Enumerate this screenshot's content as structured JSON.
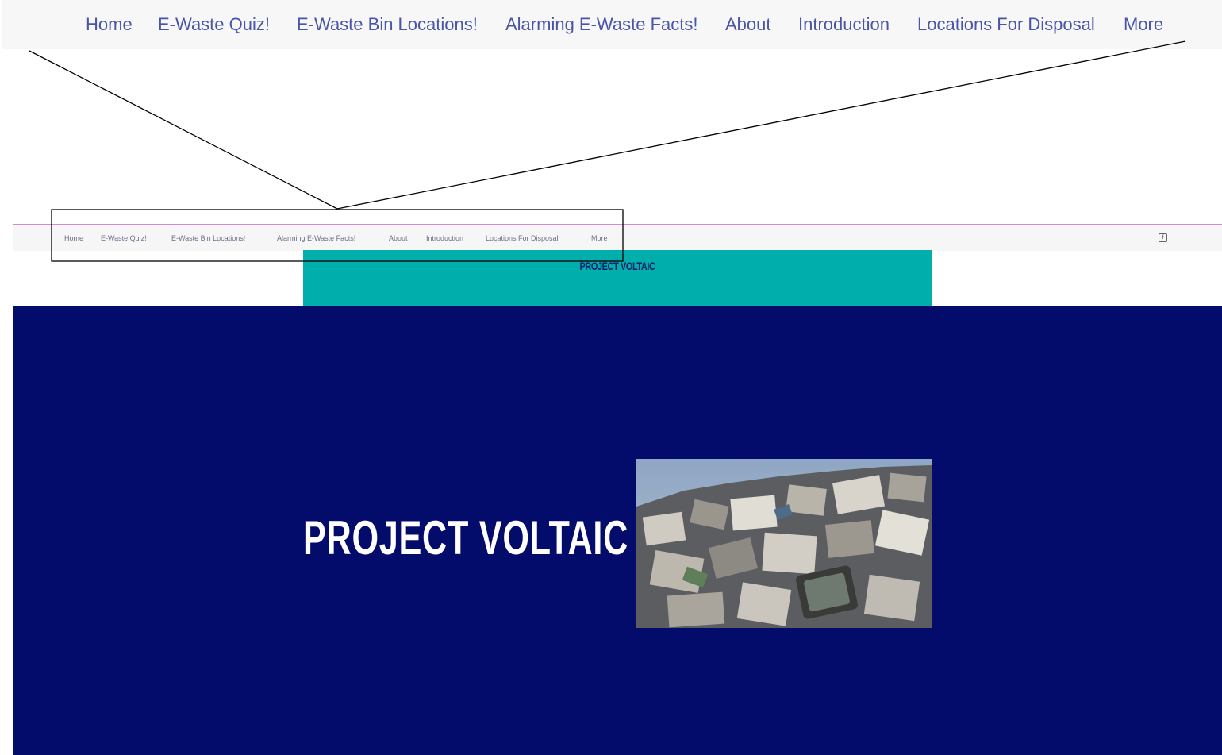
{
  "zoom_nav": {
    "items": [
      {
        "label": "Home"
      },
      {
        "label": "E-Waste Quiz!"
      },
      {
        "label": "E-Waste Bin Locations!"
      },
      {
        "label": "Alarming E-Waste Facts!"
      },
      {
        "label": "About"
      },
      {
        "label": "Introduction"
      },
      {
        "label": "Locations For Disposal"
      },
      {
        "label": "More"
      }
    ]
  },
  "site": {
    "nav": {
      "items": [
        {
          "label": "Home"
        },
        {
          "label": "E-Waste Quiz!"
        },
        {
          "label": "E-Waste Bin Locations!"
        },
        {
          "label": "Alarming E-Waste Facts!"
        },
        {
          "label": "About"
        },
        {
          "label": "Introduction"
        },
        {
          "label": "Locations For Disposal"
        },
        {
          "label": "More"
        }
      ]
    },
    "social_icon": "facebook-icon",
    "banner": {
      "title": "PROJECT VOLTAIC"
    },
    "hero": {
      "title": "PROJECT VOLTAIC",
      "image": "e-waste-pile-photo"
    }
  },
  "colors": {
    "nav_link": "#4a55a8",
    "banner": "#00aeac",
    "hero_background": "#030b6b",
    "top_border": "#d68ad6"
  }
}
